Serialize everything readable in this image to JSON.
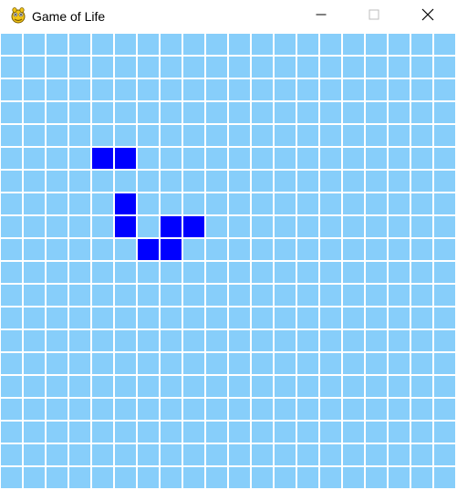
{
  "window": {
    "title": "Game of Life",
    "icon": "python-snake-icon",
    "controls": {
      "minimize": "minimize-icon",
      "maximize": "maximize-icon",
      "close": "close-icon"
    }
  },
  "board": {
    "rows": 20,
    "cols": 20,
    "dead_color": "#87CEFA",
    "alive_color": "#0000FF",
    "grid_line_color": "#FFFFFF",
    "alive_cells": [
      {
        "row": 5,
        "col": 4
      },
      {
        "row": 5,
        "col": 5
      },
      {
        "row": 7,
        "col": 5
      },
      {
        "row": 8,
        "col": 5
      },
      {
        "row": 8,
        "col": 7
      },
      {
        "row": 8,
        "col": 8
      },
      {
        "row": 9,
        "col": 6
      },
      {
        "row": 9,
        "col": 7
      }
    ]
  }
}
